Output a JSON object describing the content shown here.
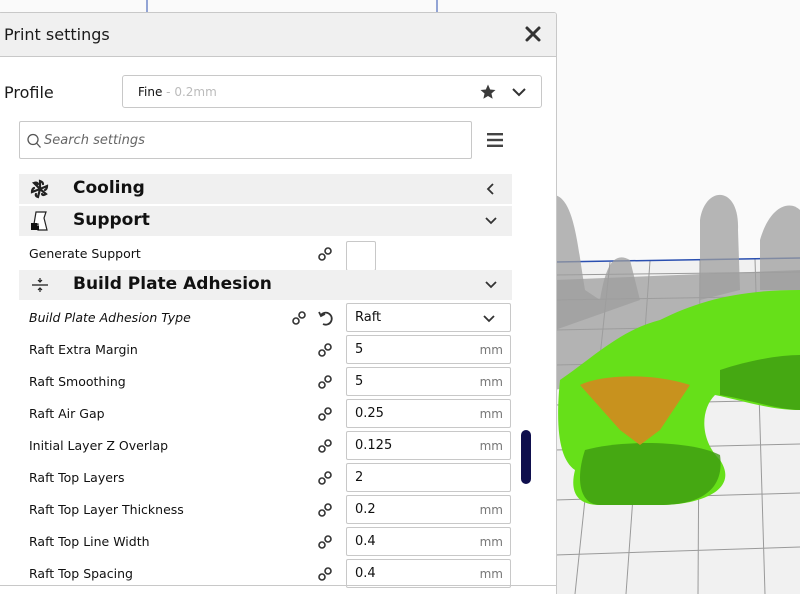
{
  "panel": {
    "title": "Print settings",
    "close_icon": "close-icon"
  },
  "profile": {
    "label": "Profile",
    "name": "Fine",
    "separator": " - ",
    "detail": "0.2mm",
    "favorite_icon": "star-icon",
    "dropdown_icon": "chevron-down-icon"
  },
  "search": {
    "placeholder": "Search settings",
    "value": "",
    "icon": "search-icon",
    "menu_icon": "hamburger-menu-icon"
  },
  "categories": [
    {
      "label": "Cooling",
      "icon": "fan-icon",
      "state": "collapsed",
      "chevron": "chevron-left-icon"
    },
    {
      "label": "Support",
      "icon": "support-icon",
      "state": "expanded",
      "chevron": "chevron-down-icon"
    },
    {
      "label": "Build Plate Adhesion",
      "icon": "adhesion-icon",
      "state": "expanded",
      "chevron": "chevron-down-icon"
    }
  ],
  "support_settings": [
    {
      "label": "Generate Support",
      "type": "checkbox",
      "checked": false
    }
  ],
  "adhesion_settings": [
    {
      "label": "Build Plate Adhesion Type",
      "type": "select",
      "value": "Raft",
      "unit": "",
      "modified": true
    },
    {
      "label": "Raft Extra Margin",
      "type": "number",
      "value": "5",
      "unit": "mm"
    },
    {
      "label": "Raft Smoothing",
      "type": "number",
      "value": "5",
      "unit": "mm"
    },
    {
      "label": "Raft Air Gap",
      "type": "number",
      "value": "0.25",
      "unit": "mm"
    },
    {
      "label": "Initial Layer Z Overlap",
      "type": "number",
      "value": "0.125",
      "unit": "mm"
    },
    {
      "label": "Raft Top Layers",
      "type": "number",
      "value": "2",
      "unit": ""
    },
    {
      "label": "Raft Top Layer Thickness",
      "type": "number",
      "value": "0.2",
      "unit": "mm"
    },
    {
      "label": "Raft Top Line Width",
      "type": "number",
      "value": "0.4",
      "unit": "mm"
    },
    {
      "label": "Raft Top Spacing",
      "type": "number",
      "value": "0.4",
      "unit": "mm"
    }
  ],
  "colors": {
    "model_green": "#66e019",
    "raft_orange": "#c8921e",
    "scrollbar": "#0f0f4d",
    "category_bg": "#f0f0f0"
  }
}
